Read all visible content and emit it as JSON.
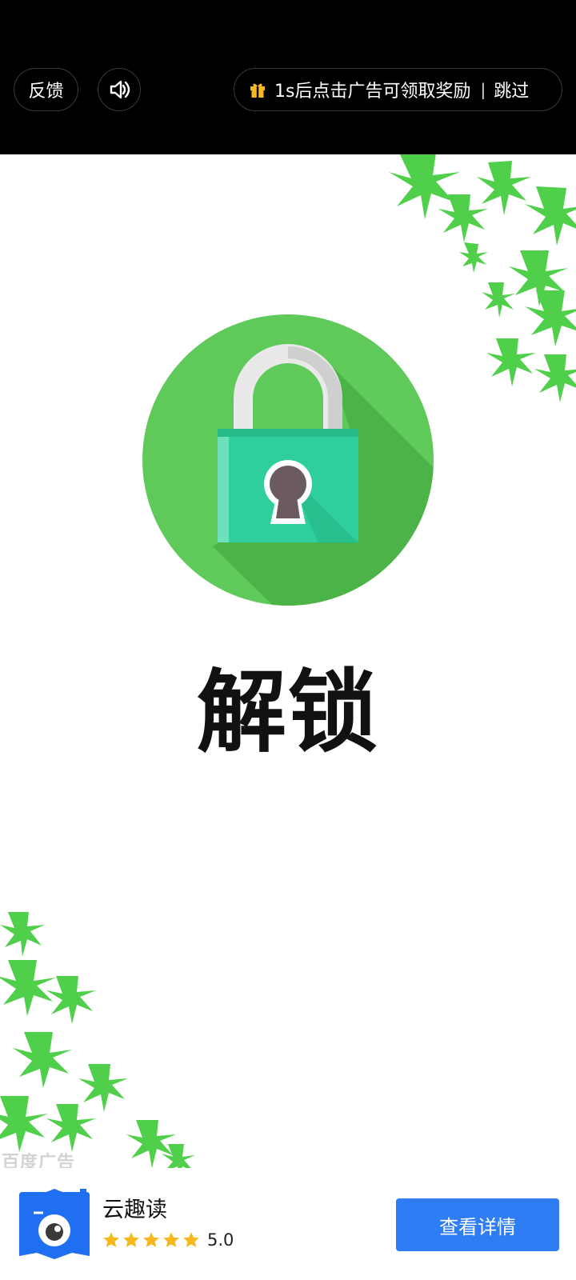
{
  "top_bar": {
    "feedback_label": "反馈",
    "sound_icon": "speaker-icon",
    "reward_text": "1s后点击广告可领取奖励",
    "separator": "|",
    "skip_label": "跳过",
    "gift_icon": "gift-icon"
  },
  "creative": {
    "headline": "解锁",
    "illustration": "padlock-icon"
  },
  "ad_mark": "百度广告",
  "app": {
    "name": "云趣读",
    "rating": "5.0",
    "stars": 5,
    "details_label": "查看详情"
  },
  "colors": {
    "top_bar_bg": "#000000",
    "circle_green": "#5fc95a",
    "lock_teal": "#2ecf9c",
    "leaf_green": "#4fcf4a",
    "button_blue": "#2f7df5",
    "star_yellow": "#f6b81c",
    "app_icon_blue": "#1f6ff0"
  }
}
